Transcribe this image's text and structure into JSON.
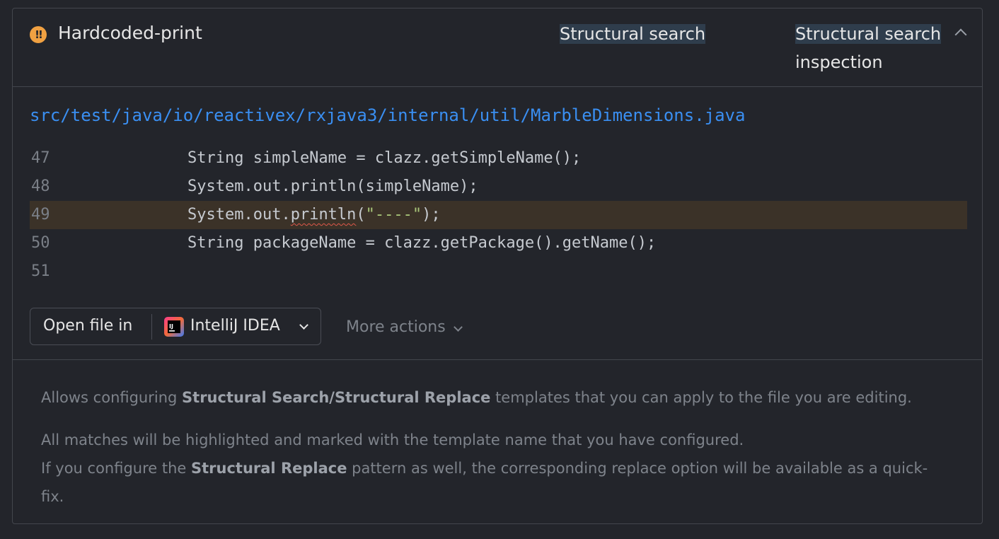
{
  "header": {
    "title": "Hardcoded-print",
    "tag_primary": "Structural search",
    "tag_secondary_line1": "Structural search",
    "tag_secondary_line2": "inspection",
    "severity_icon": "warning-icon"
  },
  "file": {
    "path": "src/test/java/io/reactivex/rxjava3/internal/util/MarbleDimensions.java"
  },
  "code": {
    "lines": [
      {
        "number": "47",
        "text": "String simpleName = clazz.getSimpleName();"
      },
      {
        "number": "48",
        "text": "System.out.println(simpleName);"
      },
      {
        "number": "49",
        "pre": "System.out.",
        "flagged": "println",
        "open": "(",
        "string": "\"----\"",
        "close": ");"
      },
      {
        "number": "50",
        "text": "String packageName = clazz.getPackage().getName();"
      },
      {
        "number": "51",
        "text": ""
      }
    ],
    "highlighted_line": "49"
  },
  "actions": {
    "open_label": "Open file in",
    "ide_label": "IntelliJ IDEA",
    "more_label": "More actions"
  },
  "description": {
    "p1_before": "Allows configuring ",
    "p1_bold": "Structural Search/Structural Replace",
    "p1_after": " templates that you can apply to the file you are editing.",
    "p2": "All matches will be highlighted and marked with the template name that you have configured.",
    "p3_before": "If you configure the ",
    "p3_bold": "Structural Replace",
    "p3_after": " pattern as well, the corresponding replace option will be available as a quick-fix."
  },
  "colors": {
    "background": "#23252b",
    "accent_link": "#3a8ff2",
    "warning": "#f0a142",
    "highlight_line": "#3b3228"
  }
}
